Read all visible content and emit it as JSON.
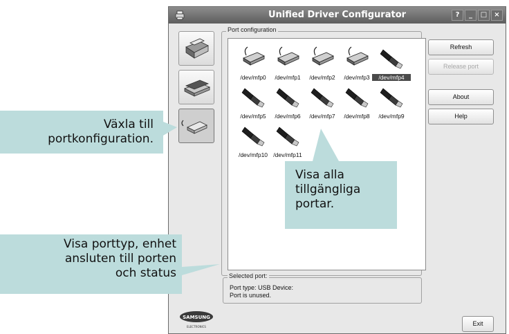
{
  "window": {
    "title": "Unified Driver Configurator",
    "controls": [
      "?",
      "_",
      "□",
      "×"
    ]
  },
  "sidebar": {
    "items": [
      {
        "name": "printers",
        "icon": "printer-icon",
        "active": false
      },
      {
        "name": "scanners",
        "icon": "scanner-icon",
        "active": false
      },
      {
        "name": "ports",
        "icon": "port-connector-icon",
        "active": true
      }
    ]
  },
  "port_configuration": {
    "legend": "Port configuration",
    "ports": [
      {
        "label": "/dev/mfp0",
        "type": "parallel-port-icon",
        "selected": false
      },
      {
        "label": "/dev/mfp1",
        "type": "parallel-port-icon",
        "selected": false
      },
      {
        "label": "/dev/mfp2",
        "type": "parallel-port-icon",
        "selected": false
      },
      {
        "label": "/dev/mfp3",
        "type": "parallel-port-icon",
        "selected": false
      },
      {
        "label": "/dev/mfp4",
        "type": "usb-plug-icon",
        "selected": true
      },
      {
        "label": "/dev/mfp5",
        "type": "usb-plug-icon",
        "selected": false
      },
      {
        "label": "/dev/mfp6",
        "type": "usb-plug-icon",
        "selected": false
      },
      {
        "label": "/dev/mfp7",
        "type": "usb-plug-icon",
        "selected": false
      },
      {
        "label": "/dev/mfp8",
        "type": "usb-plug-icon",
        "selected": false
      },
      {
        "label": "/dev/mfp9",
        "type": "usb-plug-icon",
        "selected": false
      },
      {
        "label": "/dev/mfp10",
        "type": "usb-plug-icon",
        "selected": false
      },
      {
        "label": "/dev/mfp11",
        "type": "usb-plug-icon",
        "selected": false
      }
    ]
  },
  "selected_port": {
    "legend": "Selected port:",
    "line1": "Port type: USB   Device:",
    "line2": "Port is unused."
  },
  "buttons": {
    "refresh": "Refresh",
    "release_port": "Release port",
    "about": "About",
    "help": "Help",
    "exit": "Exit"
  },
  "logo": {
    "text": "SAMSUNG",
    "sub": "ELECTRONICS"
  },
  "callouts": {
    "switch": {
      "line1": "Växla till",
      "line2": "portkonfiguration."
    },
    "ports": {
      "line1": "Visa alla",
      "line2": "tillgängliga",
      "line3": "portar."
    },
    "info": {
      "line1": "Visa porttyp, enhet",
      "line2": "ansluten till porten",
      "line3": "och status"
    }
  },
  "colors": {
    "callout": "#bcdcdc",
    "titlebar": "#6e6e6e",
    "window": "#e8e8e8",
    "selection": "#4a4a4a"
  }
}
